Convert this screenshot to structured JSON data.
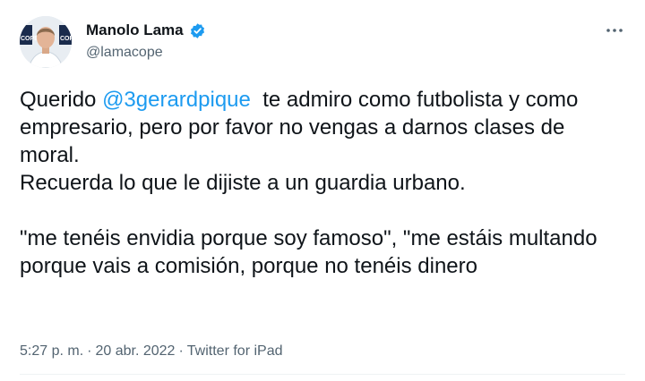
{
  "author": {
    "display_name": "Manolo Lama",
    "handle": "@lamacope",
    "verified": true,
    "avatar_badge_text": "COPE"
  },
  "tweet": {
    "text_before_mention": "Querido ",
    "mention": "@3gerardpique",
    "text_after_mention": "  te admiro como futbolista y como empresario, pero por favor no vengas a darnos clases de moral.\nRecuerda lo que le dijiste a un guardia urbano.\n\n\"me tenéis envidia porque soy famoso\", \"me estáis multando porque vais a comisión, porque no tenéis dinero"
  },
  "meta": {
    "time": "5:27 p. m.",
    "separator_1": "·",
    "date": "20 abr. 2022",
    "separator_2": "·",
    "source": "Twitter for iPad"
  },
  "colors": {
    "link": "#1d9bf0",
    "text": "#0f1419",
    "secondary": "#536471"
  },
  "icons": {
    "verified": "verified-badge-icon",
    "more": "more-options-icon"
  }
}
